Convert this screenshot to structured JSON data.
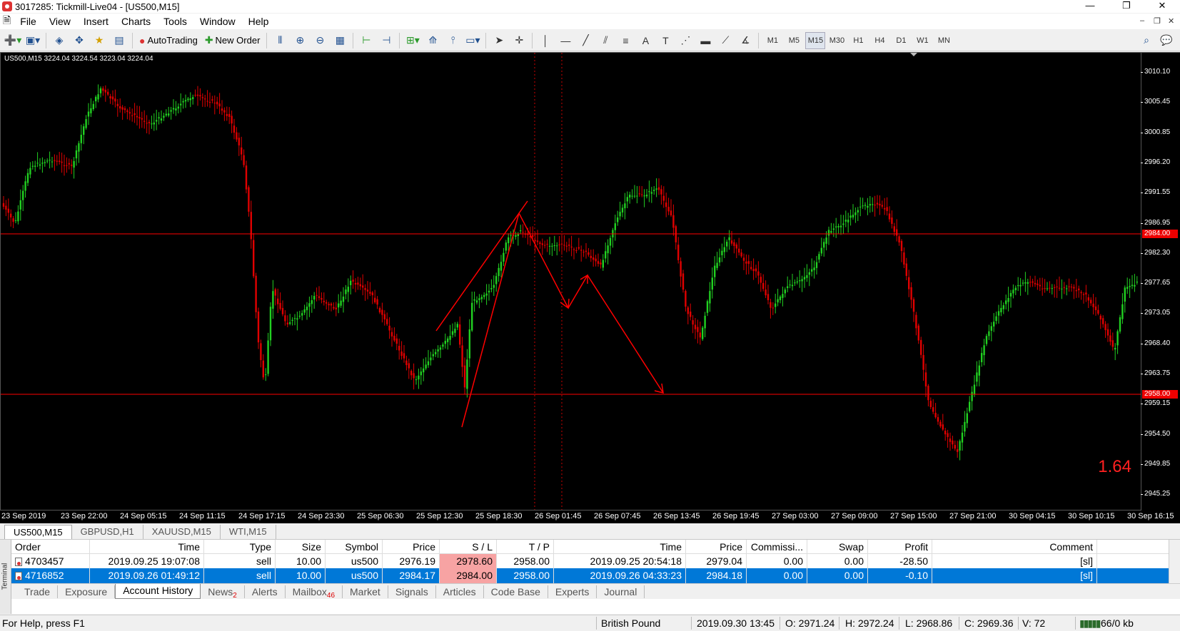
{
  "window": {
    "title": "3017285: Tickmill-Live04 - [US500,M15]",
    "controls": [
      "—",
      "❐",
      "✕"
    ]
  },
  "menu": [
    "File",
    "View",
    "Insert",
    "Charts",
    "Tools",
    "Window",
    "Help"
  ],
  "toolbar": {
    "autotrading_label": "AutoTrading",
    "new_order_label": "New Order",
    "timeframes": [
      "M1",
      "M5",
      "M15",
      "M30",
      "H1",
      "H4",
      "D1",
      "W1",
      "MN"
    ],
    "active_timeframe": "M15"
  },
  "chart": {
    "header": "US500,M15  3224.04 3224.54 3223.04 3224.04",
    "watermark_value": "1.64",
    "price_labels": [
      "3010.10",
      "3005.45",
      "3000.85",
      "2996.20",
      "2991.55",
      "2986.95",
      "2982.30",
      "2977.65",
      "2973.05",
      "2968.40",
      "2963.75",
      "2959.15",
      "2954.50",
      "2949.85",
      "2945.25"
    ],
    "sl_tag": "2984.00",
    "tp_tag": "2958.00",
    "time_labels": [
      "23 Sep 2019",
      "23 Sep 22:00",
      "24 Sep 05:15",
      "24 Sep 11:15",
      "24 Sep 17:15",
      "24 Sep 23:30",
      "25 Sep 06:30",
      "25 Sep 12:30",
      "25 Sep 18:30",
      "26 Sep 01:45",
      "26 Sep 07:45",
      "26 Sep 13:45",
      "26 Sep 19:45",
      "27 Sep 03:00",
      "27 Sep 09:00",
      "27 Sep 15:00",
      "27 Sep 21:00",
      "30 Sep 04:15",
      "30 Sep 10:15",
      "30 Sep 16:15"
    ],
    "colors": {
      "bull": "#21d021",
      "bear": "#e00000",
      "line": "#ff0000",
      "background": "#000000"
    }
  },
  "chart_tabs": [
    "US500,M15",
    "GBPUSD,H1",
    "XAUUSD,M15",
    "WTI,M15"
  ],
  "terminal": {
    "side_label": "Terminal",
    "columns": [
      "Order",
      "Time",
      "Type",
      "Size",
      "Symbol",
      "Price",
      "S / L",
      "T / P",
      "Time",
      "Price",
      "Commissi...",
      "Swap",
      "Profit",
      "Comment"
    ],
    "rows": [
      {
        "order": "4703457",
        "open_time": "2019.09.25 19:07:08",
        "type": "sell",
        "size": "10.00",
        "symbol": "us500",
        "price": "2976.19",
        "sl": "2978.60",
        "tp": "2958.00",
        "close_time": "2019.09.25 20:54:18",
        "close_price": "2979.04",
        "commission": "0.00",
        "swap": "0.00",
        "profit": "-28.50",
        "comment": "[sl]"
      },
      {
        "order": "4716852",
        "open_time": "2019.09.26 01:49:12",
        "type": "sell",
        "size": "10.00",
        "symbol": "us500",
        "price": "2984.17",
        "sl": "2984.00",
        "tp": "2958.00",
        "close_time": "2019.09.26 04:33:23",
        "close_price": "2984.18",
        "commission": "0.00",
        "swap": "0.00",
        "profit": "-0.10",
        "comment": "[sl]"
      }
    ],
    "tabs": [
      {
        "label": "Trade"
      },
      {
        "label": "Exposure"
      },
      {
        "label": "Account History"
      },
      {
        "label": "News",
        "badge": "2"
      },
      {
        "label": "Alerts"
      },
      {
        "label": "Mailbox",
        "badge": "46"
      },
      {
        "label": "Market"
      },
      {
        "label": "Signals"
      },
      {
        "label": "Articles"
      },
      {
        "label": "Code Base"
      },
      {
        "label": "Experts"
      },
      {
        "label": "Journal"
      }
    ],
    "active_tab": "Account History"
  },
  "status": {
    "help": "For Help, press F1",
    "profile": "British Pound",
    "datetime": "2019.09.30 13:45",
    "open": "O: 2971.24",
    "high": "H: 2972.24",
    "low": "L: 2968.86",
    "close": "C: 2969.36",
    "volume": "V: 72",
    "traffic": "66/0 kb"
  }
}
